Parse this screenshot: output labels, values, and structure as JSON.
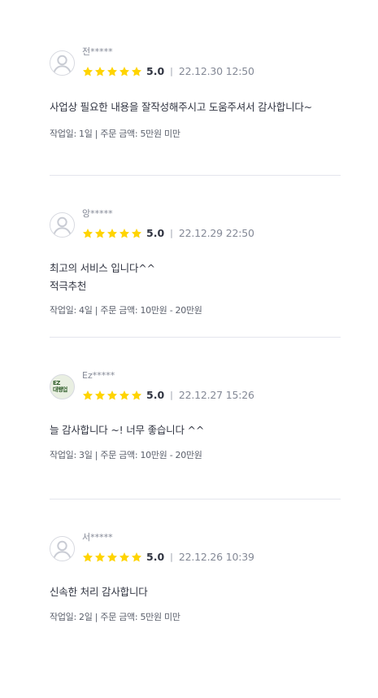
{
  "colors": {
    "star": "#ffd400",
    "text_primary": "#303441",
    "text_secondary": "#848996",
    "divider_line": "#e4e5ed"
  },
  "reviews": [
    {
      "username": "전*****",
      "avatar": "default-avatar-icon",
      "rating_stars": 5,
      "score": "5.0",
      "separator": "|",
      "date": "22.12.30 12:50",
      "body": "사업상 필요한 내용을 잘작성해주시고 도움주셔서 감사합니다~",
      "order_info": "작업일: 1일 | 주문 금액: 5만원 미만"
    },
    {
      "username": "앙*****",
      "avatar": "default-avatar-icon",
      "rating_stars": 5,
      "score": "5.0",
      "separator": "|",
      "date": "22.12.29 22:50",
      "body": "최고의 서비스 입니다^^\n적극추천",
      "order_info": "작업일: 4일 | 주문 금액: 10만원 - 20만원"
    },
    {
      "username": "Ez*****",
      "avatar": "user-photo-avatar",
      "avatar_text": "EZ\n대행업",
      "rating_stars": 5,
      "score": "5.0",
      "separator": "|",
      "date": "22.12.27 15:26",
      "body": "늘 감사합니다 ~! 너무 좋습니다 ^^",
      "order_info": "작업일: 3일 | 주문 금액: 10만원 - 20만원"
    },
    {
      "username": "서*****",
      "avatar": "default-avatar-icon",
      "rating_stars": 5,
      "score": "5.0",
      "separator": "|",
      "date": "22.12.26 10:39",
      "body": "신속한 처리 감사합니다",
      "order_info": "작업일: 2일 | 주문 금액: 5만원 미만"
    }
  ]
}
